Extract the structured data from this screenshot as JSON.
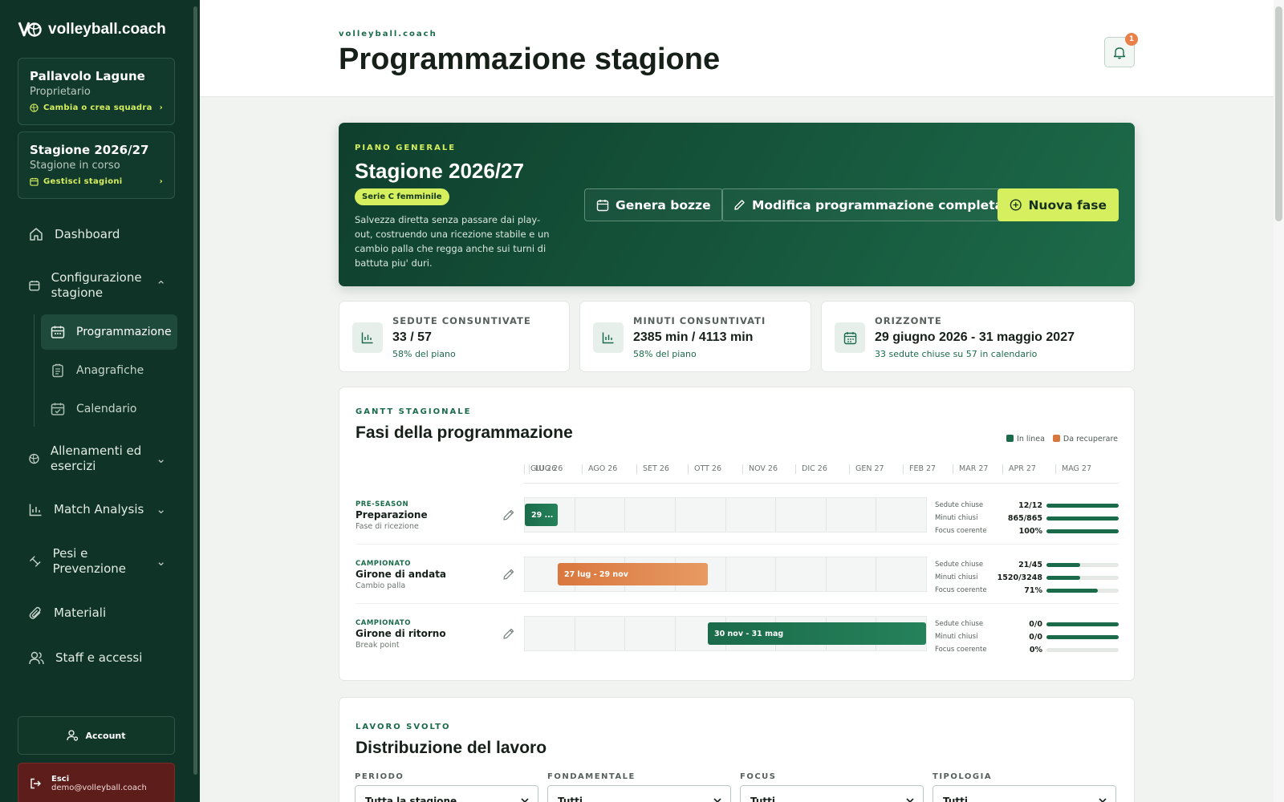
{
  "brand": {
    "name": "volleyball.coach"
  },
  "team": {
    "name": "Pallavolo Lagune",
    "role": "Proprietario",
    "link": "Cambia o crea squadra"
  },
  "season_card": {
    "name": "Stagione 2026/27",
    "status": "Stagione in corso",
    "link": "Gestisci stagioni"
  },
  "nav": {
    "dashboard": "Dashboard",
    "config": "Configurazione stagione",
    "sub": [
      "Programmazione",
      "Anagrafiche",
      "Calendario"
    ],
    "training": "Allenamenti ed esercizi",
    "match": "Match Analysis",
    "weights": "Pesi e Prevenzione",
    "materials": "Materiali",
    "staff": "Staff e accessi"
  },
  "account": {
    "label": "Account"
  },
  "logout": {
    "label": "Esci",
    "email": "demo@volleyball.coach"
  },
  "header": {
    "kicker": "volleyball.coach",
    "title": "Programmazione stagione",
    "notifications": "1"
  },
  "hero": {
    "kicker": "PIANO GENERALE",
    "title": "Stagione 2026/27",
    "league": "Serie C femminile",
    "description": "Salvezza diretta senza passare dai play-out, costruendo una ricezione stabile e un cambio palla che regga anche sui turni di battuta piu' duri.",
    "btn_drafts": "Genera bozze",
    "btn_edit": "Modifica programmazione completa",
    "btn_new": "Nuova fase"
  },
  "stats": [
    {
      "label": "SEDUTE CONSUNTIVATE",
      "value": "33 / 57",
      "sub": "58% del piano",
      "icon": "bar-chart-icon"
    },
    {
      "label": "MINUTI CONSUNTIVATI",
      "value": "2385 min / 4113 min",
      "sub": "58% del piano",
      "icon": "bar-chart-icon"
    },
    {
      "label": "ORIZZONTE",
      "value": "29 giugno 2026 - 31 maggio 2027",
      "sub": "33 sedute chiuse su 57 in calendario",
      "icon": "calendar-icon"
    }
  ],
  "gantt": {
    "kicker": "GANTT STAGIONALE",
    "title": "Fasi della programmazione",
    "legend": [
      {
        "label": "In linea",
        "color": "#1b6b4a"
      },
      {
        "label": "Da recuperare",
        "color": "#d9773e"
      }
    ],
    "months": [
      "GIU 26",
      "LUG 26",
      "AGO 26",
      "SET 26",
      "OTT 26",
      "NOV 26",
      "DIC 26",
      "GEN 27",
      "FEB 27",
      "MAR 27",
      "APR 27",
      "MAG 27"
    ],
    "metric_labels": [
      "Sedute chiuse",
      "Minuti chiusi",
      "Focus coerente"
    ],
    "phases": [
      {
        "kind": "PRE-SEASON",
        "name": "Preparazione",
        "focus": "Fase di ricezione",
        "bar_label": "29 ...",
        "status": "green",
        "start_frac": 0.0,
        "end_frac": 0.082,
        "sedute": "12/12",
        "minuti": "865/865",
        "focus_pct": "100%",
        "fill": [
          1.0,
          1.0,
          1.0
        ]
      },
      {
        "kind": "CAMPIONATO",
        "name": "Girone di andata",
        "focus": "Cambio palla",
        "bar_label": "27 lug - 29 nov",
        "status": "orange",
        "start_frac": 0.082,
        "end_frac": 0.456,
        "sedute": "21/45",
        "minuti": "1520/3248",
        "focus_pct": "71%",
        "fill": [
          0.467,
          0.468,
          0.71
        ]
      },
      {
        "kind": "CAMPIONATO",
        "name": "Girone di ritorno",
        "focus": "Break point",
        "bar_label": "30 nov - 31 mag",
        "status": "green",
        "start_frac": 0.456,
        "end_frac": 1.0,
        "sedute": "0/0",
        "minuti": "0/0",
        "focus_pct": "0%",
        "fill": [
          1.0,
          1.0,
          0.0
        ]
      }
    ]
  },
  "work": {
    "kicker": "LAVORO SVOLTO",
    "title": "Distribuzione del lavoro",
    "filters": [
      {
        "label": "PERIODO",
        "value": "Tutta la stagione"
      },
      {
        "label": "FONDAMENTALE",
        "value": "Tutti"
      },
      {
        "label": "FOCUS",
        "value": "Tutti"
      },
      {
        "label": "TIPOLOGIA",
        "value": "Tutti"
      }
    ]
  }
}
